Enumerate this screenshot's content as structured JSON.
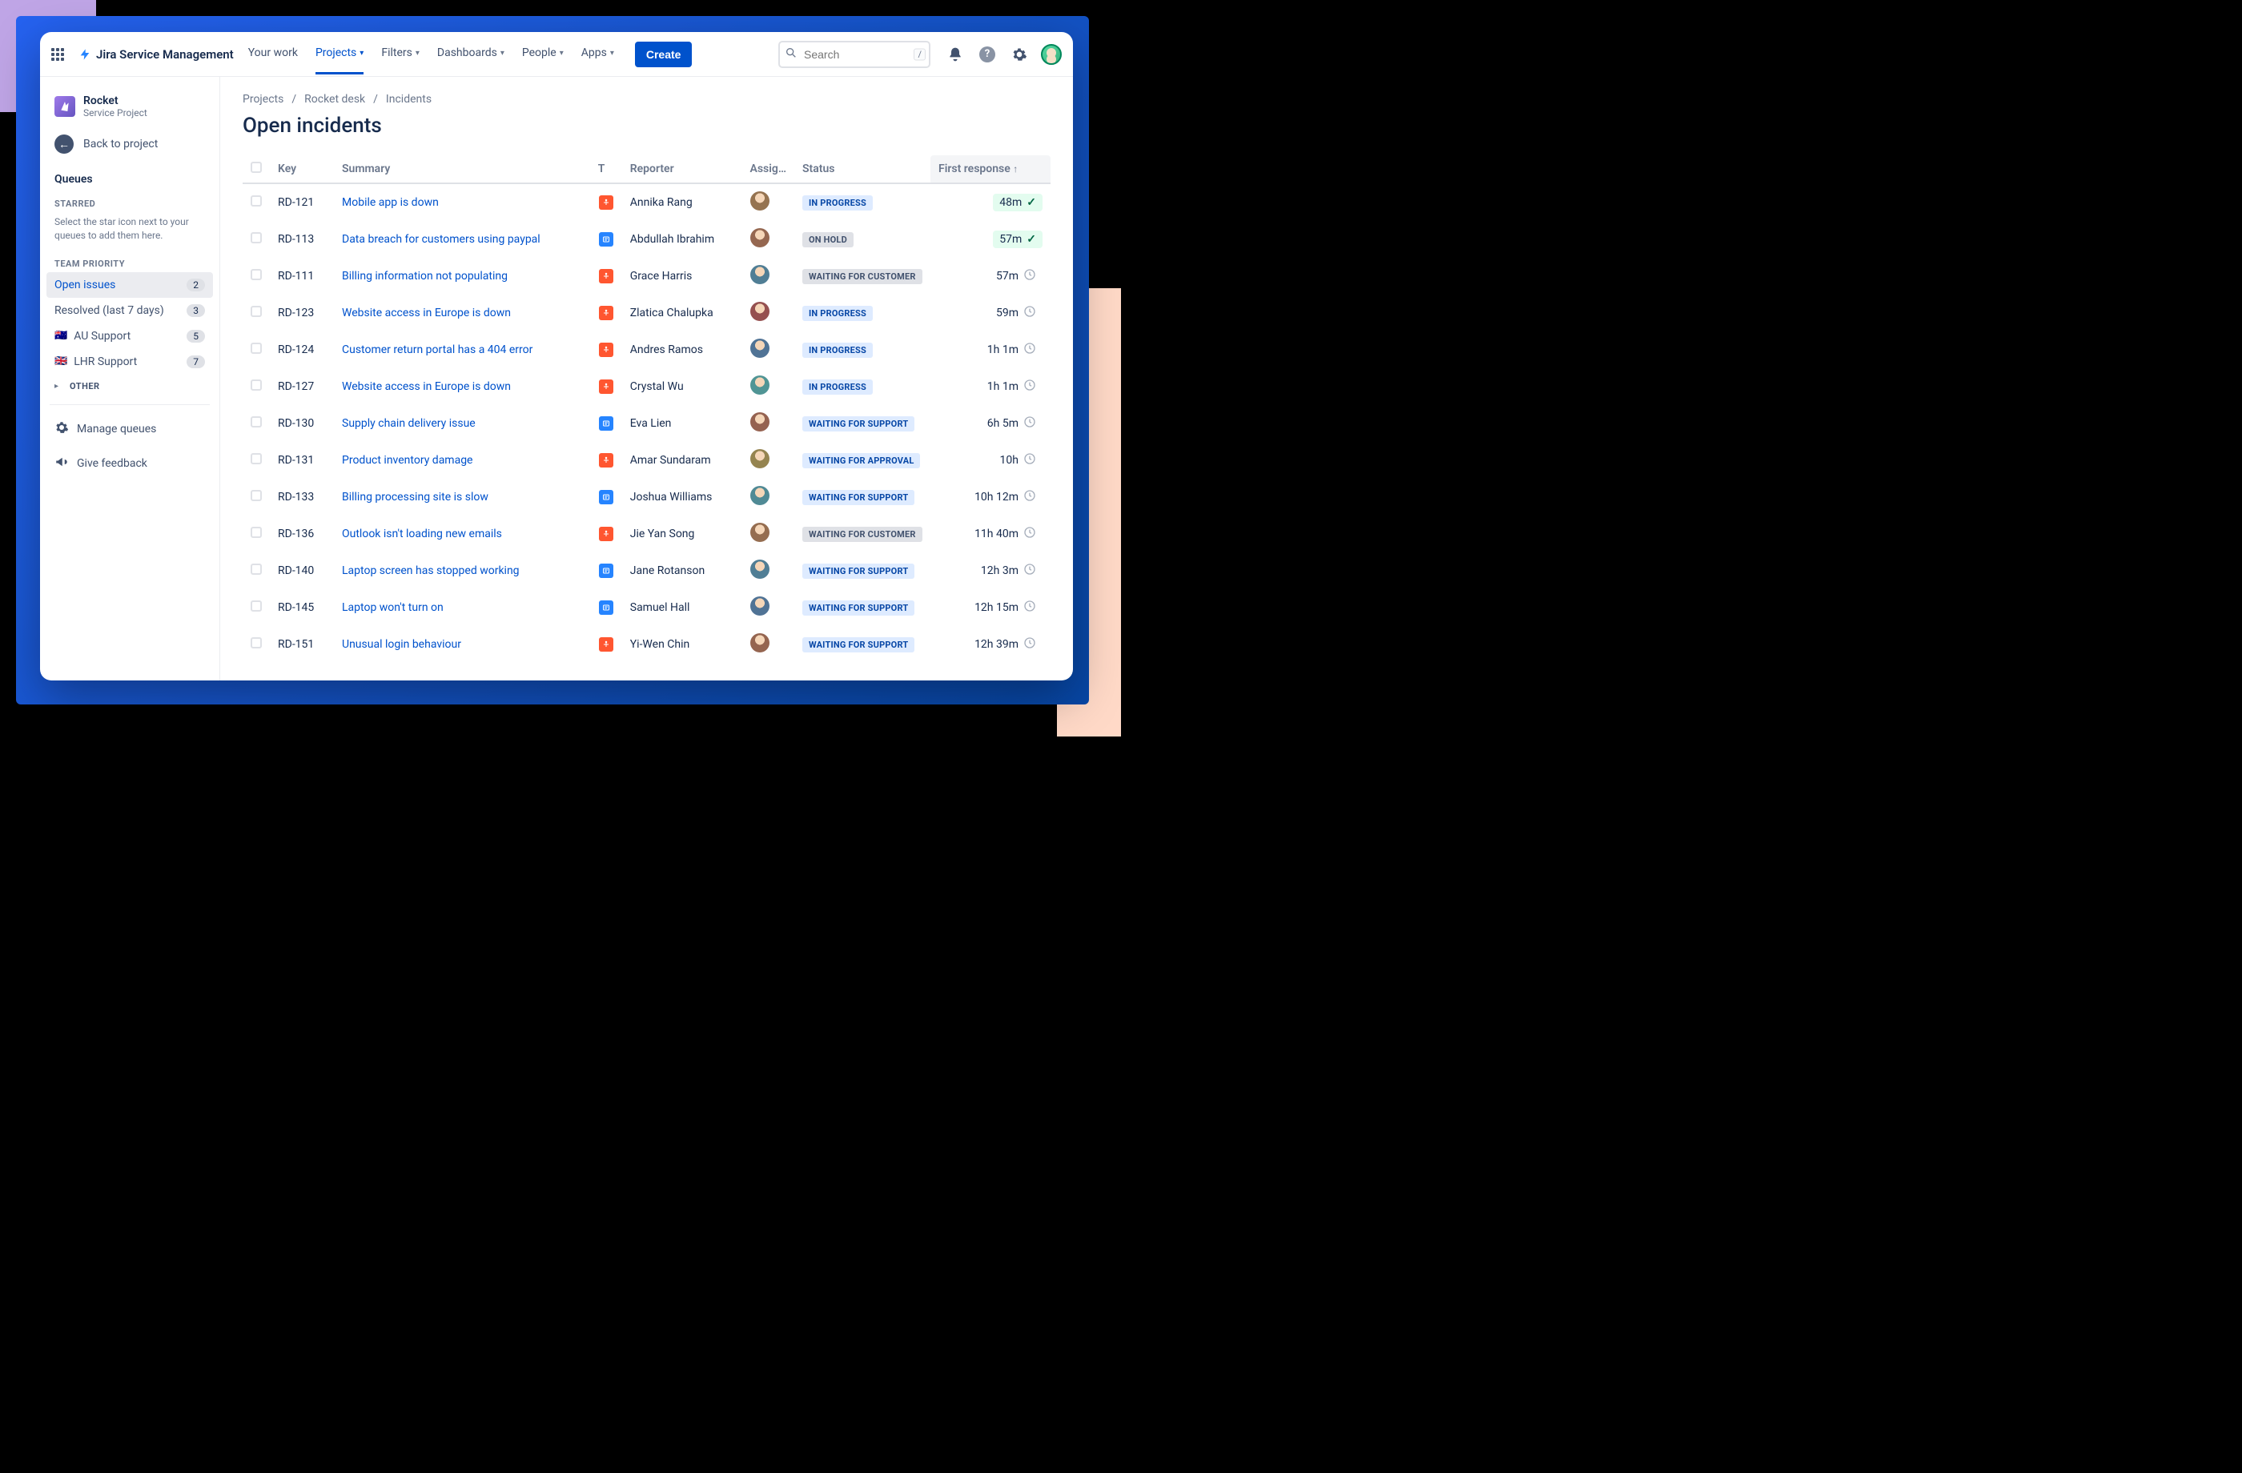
{
  "product_name": "Jira Service Management",
  "topnav": {
    "items": [
      "Your work",
      "Projects",
      "Filters",
      "Dashboards",
      "People",
      "Apps"
    ],
    "active_index": 1,
    "create_label": "Create",
    "search_placeholder": "Search",
    "slash_hint": "/"
  },
  "project": {
    "name": "Rocket",
    "subtitle": "Service Project",
    "back_label": "Back to project"
  },
  "sidebar": {
    "queues_label": "Queues",
    "starred_label": "STARRED",
    "starred_hint": "Select the star icon next to your queues to add them here.",
    "team_priority_label": "TEAM PRIORITY",
    "items": [
      {
        "label": "Open issues",
        "count": "2",
        "active": true,
        "flag": ""
      },
      {
        "label": "Resolved (last 7 days)",
        "count": "3",
        "active": false,
        "flag": ""
      },
      {
        "label": "AU Support",
        "count": "5",
        "active": false,
        "flag": "🇦🇺"
      },
      {
        "label": "LHR Support",
        "count": "7",
        "active": false,
        "flag": "🇬🇧"
      }
    ],
    "other_label": "OTHER",
    "manage_label": "Manage queues",
    "feedback_label": "Give feedback"
  },
  "breadcrumbs": [
    "Projects",
    "Rocket desk",
    "Incidents"
  ],
  "page_title": "Open incidents",
  "columns": {
    "key": "Key",
    "summary": "Summary",
    "t": "T",
    "reporter": "Reporter",
    "assignee": "Assig…",
    "status": "Status",
    "first_response": "First response"
  },
  "status_colors": {
    "IN PROGRESS": "st-inprogress",
    "ON HOLD": "st-onhold",
    "WAITING FOR CUSTOMER": "st-waitcust",
    "WAITING FOR SUPPORT": "st-waitsupport",
    "WAITING FOR APPROVAL": "st-waitapproval"
  },
  "rows": [
    {
      "key": "RD-121",
      "summary": "Mobile app is down",
      "type": "orange",
      "reporter": "Annika Rang",
      "assignee_hue": 30,
      "status": "IN PROGRESS",
      "resp": "48m",
      "met": true
    },
    {
      "key": "RD-113",
      "summary": "Data breach for customers using paypal",
      "type": "blue",
      "reporter": "Abdullah Ibrahim",
      "assignee_hue": 20,
      "status": "ON HOLD",
      "resp": "57m",
      "met": true
    },
    {
      "key": "RD-111",
      "summary": "Billing information not populating",
      "type": "orange",
      "reporter": "Grace Harris",
      "assignee_hue": 200,
      "status": "WAITING FOR CUSTOMER",
      "resp": "57m",
      "met": false
    },
    {
      "key": "RD-123",
      "summary": "Website access in Europe is down",
      "type": "orange",
      "reporter": "Zlatica Chalupka",
      "assignee_hue": 0,
      "status": "IN PROGRESS",
      "resp": "59m",
      "met": false
    },
    {
      "key": "RD-124",
      "summary": "Customer return portal has a 404 error",
      "type": "orange",
      "reporter": "Andres Ramos",
      "assignee_hue": 210,
      "status": "IN PROGRESS",
      "resp": "1h 1m",
      "met": false
    },
    {
      "key": "RD-127",
      "summary": "Website access in Europe is down",
      "type": "orange",
      "reporter": "Crystal Wu",
      "assignee_hue": 180,
      "status": "IN PROGRESS",
      "resp": "1h 1m",
      "met": false
    },
    {
      "key": "RD-130",
      "summary": "Supply chain delivery issue",
      "type": "blue",
      "reporter": "Eva Lien",
      "assignee_hue": 15,
      "status": "WAITING FOR SUPPORT",
      "resp": "6h 5m",
      "met": false
    },
    {
      "key": "RD-131",
      "summary": "Product inventory damage",
      "type": "orange",
      "reporter": "Amar Sundaram",
      "assignee_hue": 45,
      "status": "WAITING FOR APPROVAL",
      "resp": "10h",
      "met": false
    },
    {
      "key": "RD-133",
      "summary": "Billing processing site is slow",
      "type": "blue",
      "reporter": "Joshua Williams",
      "assignee_hue": 190,
      "status": "WAITING FOR SUPPORT",
      "resp": "10h 12m",
      "met": false
    },
    {
      "key": "RD-136",
      "summary": "Outlook isn't loading new emails",
      "type": "orange",
      "reporter": "Jie Yan Song",
      "assignee_hue": 25,
      "status": "WAITING FOR CUSTOMER",
      "resp": "11h 40m",
      "met": false
    },
    {
      "key": "RD-140",
      "summary": "Laptop screen has stopped working",
      "type": "blue",
      "reporter": "Jane Rotanson",
      "assignee_hue": 200,
      "status": "WAITING FOR SUPPORT",
      "resp": "12h 3m",
      "met": false
    },
    {
      "key": "RD-145",
      "summary": "Laptop won't turn on",
      "type": "blue",
      "reporter": "Samuel Hall",
      "assignee_hue": 210,
      "status": "WAITING FOR SUPPORT",
      "resp": "12h 15m",
      "met": false
    },
    {
      "key": "RD-151",
      "summary": "Unusual login behaviour",
      "type": "orange",
      "reporter": "Yi-Wen Chin",
      "assignee_hue": 18,
      "status": "WAITING FOR SUPPORT",
      "resp": "12h 39m",
      "met": false
    }
  ]
}
